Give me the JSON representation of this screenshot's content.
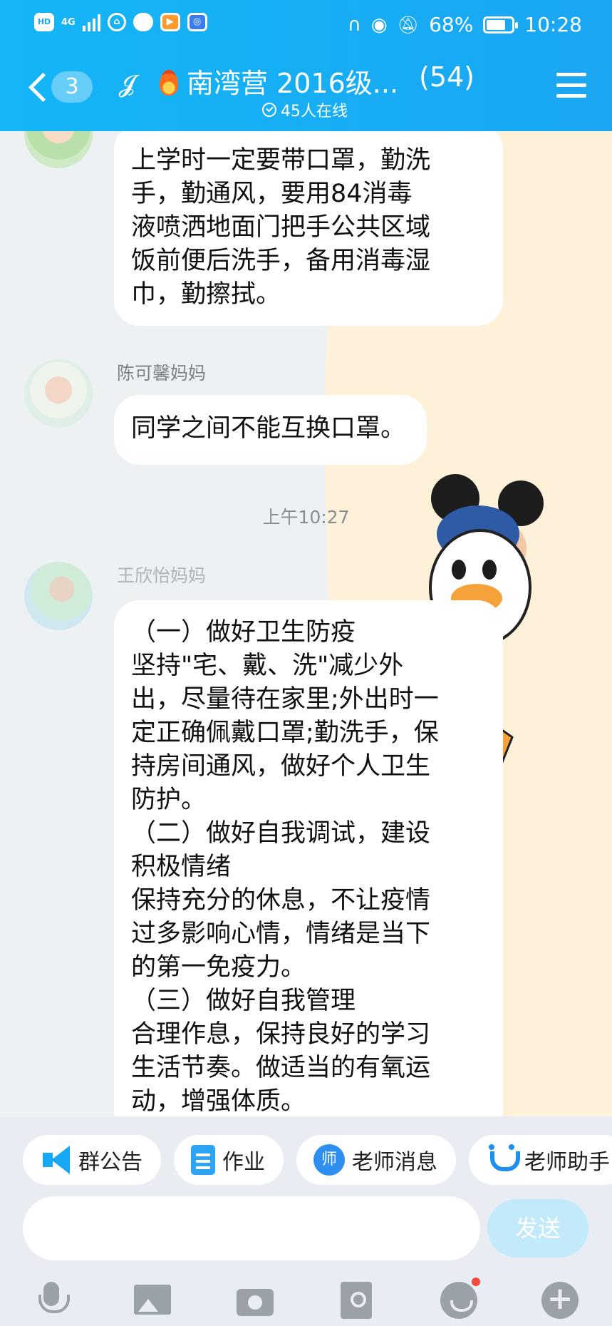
{
  "status_bar": {
    "network": "4G",
    "battery_percent": "68%",
    "time": "10:28"
  },
  "header": {
    "unread_count": "3",
    "group_title": "南湾营 2016级...",
    "member_count": "(54)",
    "online_text": "45人在线"
  },
  "messages": [
    {
      "sender": "",
      "lines": [
        "上学时一定要带口罩，勤洗",
        "手，勤通风，要用84消毒",
        "液喷洒地面门把手公共区域",
        "饭前便后洗手，备用消毒湿",
        "巾，勤擦拭。"
      ]
    },
    {
      "sender": "陈可馨妈妈",
      "lines": [
        "同学之间不能互换口罩。"
      ]
    },
    {
      "sender": "王欣怡妈妈",
      "lines": [
        "（一）做好卫生防疫",
        "坚持\"宅、戴、洗\"减少外",
        "出，尽量待在家里;外出时一",
        "定正确佩戴口罩;勤洗手，保",
        "持房间通风，做好个人卫生",
        "防护。",
        "（二）做好自我调试，建设",
        "积极情绪",
        "保持充分的休息，不让疫情",
        "过多影响心情，情绪是当下",
        "的第一免疫力。",
        "（三）做好自我管理",
        "合理作息，保持良好的学习",
        "生活节奏。做适当的有氧运",
        "动，增强体质。"
      ]
    }
  ],
  "timestamp": "上午10:27",
  "quick_actions": [
    {
      "label": "群公告",
      "icon": "megaphone-icon"
    },
    {
      "label": "作业",
      "icon": "homework-icon"
    },
    {
      "label": "老师消息",
      "icon": "teacher-icon"
    },
    {
      "label": "老师助手",
      "icon": "assistant-icon"
    }
  ],
  "input": {
    "placeholder": "",
    "send_label": "发送"
  },
  "toolbar": [
    "mic-icon",
    "image-icon",
    "camera-icon",
    "red-packet-icon",
    "emoji-icon",
    "plus-icon"
  ],
  "colors": {
    "header": "#14b6f6",
    "send_disabled": "#c2eafb",
    "notification_dot": "#f24a3c"
  }
}
